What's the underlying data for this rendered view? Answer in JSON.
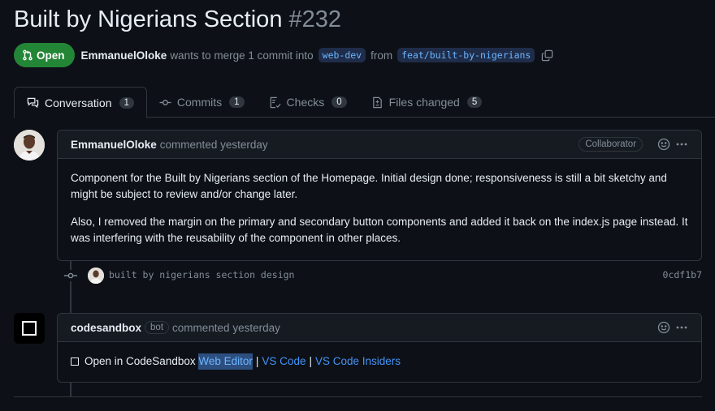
{
  "pr": {
    "title": "Built by Nigerians Section",
    "number": "#232",
    "state_label": "Open",
    "author": "EmmanuelOloke",
    "merge_text": "wants to merge 1 commit into",
    "base_branch": "web-dev",
    "from_text": "from",
    "head_branch": "feat/built-by-nigerians"
  },
  "tabs": [
    {
      "label": "Conversation",
      "count": "1"
    },
    {
      "label": "Commits",
      "count": "1"
    },
    {
      "label": "Checks",
      "count": "0"
    },
    {
      "label": "Files changed",
      "count": "5"
    }
  ],
  "comment1": {
    "author": "EmmanuelOloke",
    "action": "commented yesterday",
    "badge": "Collaborator",
    "paragraphs": [
      "Component for the Built by Nigerians section of the Homepage. Initial design done; responsiveness is still a bit sketchy and might be subject to review and/or change later.",
      "Also, I removed the margin on the primary and secondary button components and added it back on the index.js page instead. It was interfering with the reusability of the component in other places."
    ]
  },
  "commit": {
    "message": "built by nigerians section design",
    "sha": "0cdf1b7"
  },
  "comment2": {
    "author": "codesandbox",
    "bot_label": "bot",
    "action": "commented yesterday",
    "prefix": "Open in CodeSandbox",
    "links": [
      "Web Editor",
      "VS Code",
      "VS Code Insiders"
    ],
    "separator": "|"
  },
  "colors": {
    "open_badge": "#238636",
    "link": "#4493f8",
    "background": "#0d1117"
  }
}
